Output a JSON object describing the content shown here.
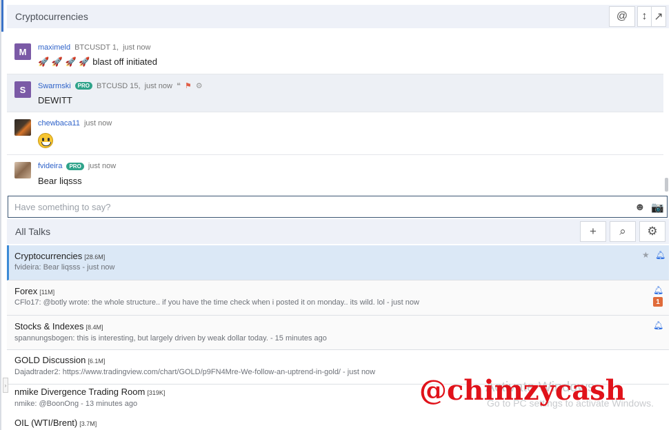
{
  "chat": {
    "title": "Cryptocurrencies",
    "buttons": {
      "mention": "@",
      "resize": "↕",
      "popout": "↗"
    },
    "messages": [
      {
        "avatar_letter": "M",
        "username": "maximeld",
        "pro": "",
        "context": "BTCUSDT 1,",
        "time": "just now",
        "emoji": "🚀 🚀 🚀 🚀",
        "text": "blast off initiated"
      },
      {
        "avatar_letter": "S",
        "username": "Swarmski",
        "pro": "PRO",
        "context": "BTCUSD 15,",
        "time": "just now",
        "text": "DEWITT"
      },
      {
        "avatar_letter": "",
        "username": "chewbaca11",
        "pro": "",
        "context": "",
        "time": "just now",
        "text": ""
      },
      {
        "avatar_letter": "",
        "username": "fvideira",
        "pro": "PRO",
        "context": "",
        "time": "just now",
        "text": "Bear liqsss"
      }
    ],
    "input_placeholder": "Have something to say?"
  },
  "talks": {
    "title": "All Talks",
    "buttons": {
      "add": "+",
      "search": "⌕",
      "settings": "⚙"
    },
    "rooms": [
      {
        "name": "Cryptocurrencies",
        "count": "[28.6M]",
        "last": "fvideira: Bear liqsss - just now"
      },
      {
        "name": "Forex",
        "count": "[11M]",
        "last": "CFlo17: @botly wrote: the whole structure.. if you have the time check when i posted it on monday.. its wild. lol - just now",
        "badge": "1"
      },
      {
        "name": "Stocks & Indexes",
        "count": "[8.4M]",
        "last": "spannungsbogen: this is interesting, but largely driven by weak dollar today. - 15 minutes ago"
      },
      {
        "name": "GOLD Discussion",
        "count": "[6.1M]",
        "last": "Dajadtrader2: https://www.tradingview.com/chart/GOLD/p9FN4Mre-We-follow-an-uptrend-in-gold/ - just now"
      },
      {
        "name": "nmike Divergence Trading Room",
        "count": "[319K]",
        "last": "nmike: @BoonOng - 13 minutes ago"
      },
      {
        "name": "OIL (WTI/Brent)",
        "count": "[3.7M]",
        "last": ""
      }
    ]
  },
  "watermark": {
    "title": "Activate Windows",
    "subtitle": "Go to PC settings to activate Windows."
  },
  "overlay_text": "@chimzycash",
  "colors": {
    "accent": "#3b8ad6",
    "pro_badge": "#2fa38a",
    "username": "#2e62c9",
    "overlay": "#e0121a",
    "bell": "#1e64e0"
  }
}
